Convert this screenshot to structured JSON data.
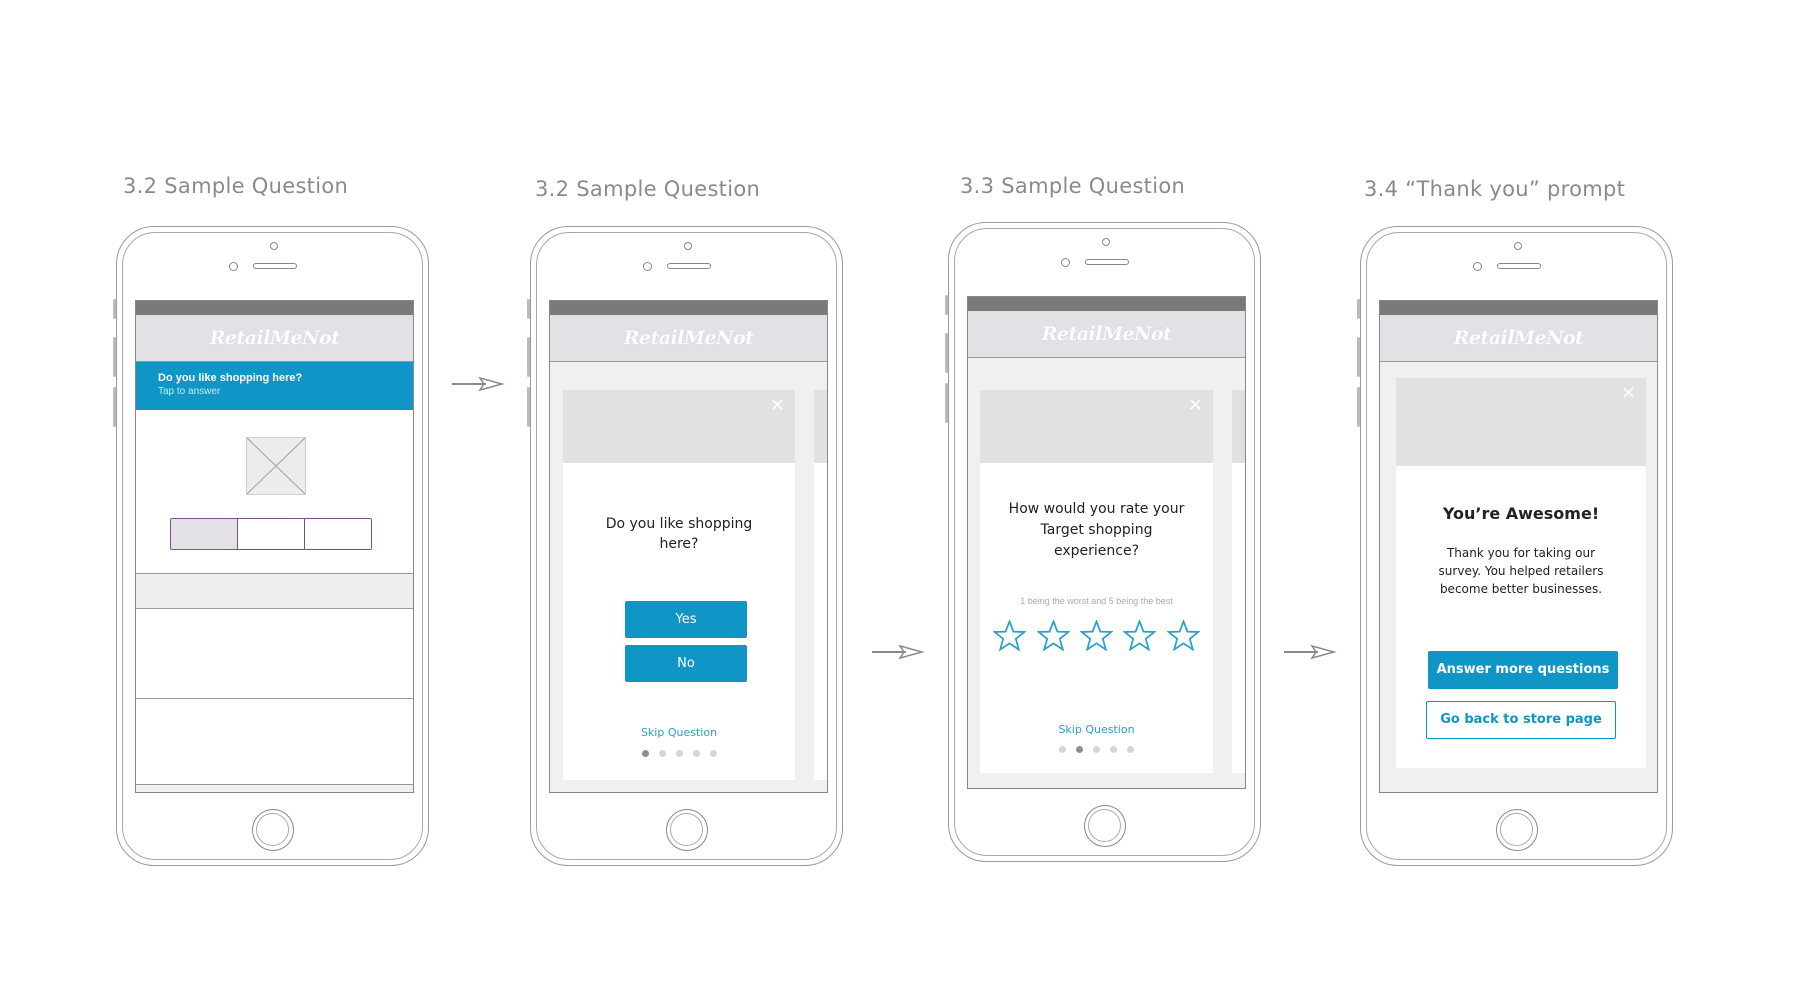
{
  "steps": [
    {
      "title": "3.2 Sample Question"
    },
    {
      "title": "3.2 Sample Question"
    },
    {
      "title": "3.3 Sample Question"
    },
    {
      "title": "3.4 “Thank you” prompt"
    }
  ],
  "brand": {
    "logo": "RetailMeNot",
    "accent": "#0f96c6"
  },
  "screen1": {
    "banner_question": "Do you like shopping here?",
    "banner_hint": "Tap to answer"
  },
  "screen2": {
    "question": "Do you like shopping here?",
    "yes_label": "Yes",
    "no_label": "No",
    "skip_label": "Skip Question",
    "close": "×",
    "active_dot": 1,
    "dot_count": 5
  },
  "screen3": {
    "question": "How would you rate your Target shopping experience?",
    "hint": "1 being the worst and 5 being the best",
    "star_count": 5,
    "skip_label": "Skip Question",
    "close": "×",
    "active_dot": 2,
    "dot_count": 5
  },
  "screen4": {
    "heading": "You’re Awesome!",
    "body": "Thank you for taking our survey. You helped retailers become better businesses.",
    "primary_label": "Answer more questions",
    "secondary_label": "Go back to store page",
    "close": "×"
  }
}
